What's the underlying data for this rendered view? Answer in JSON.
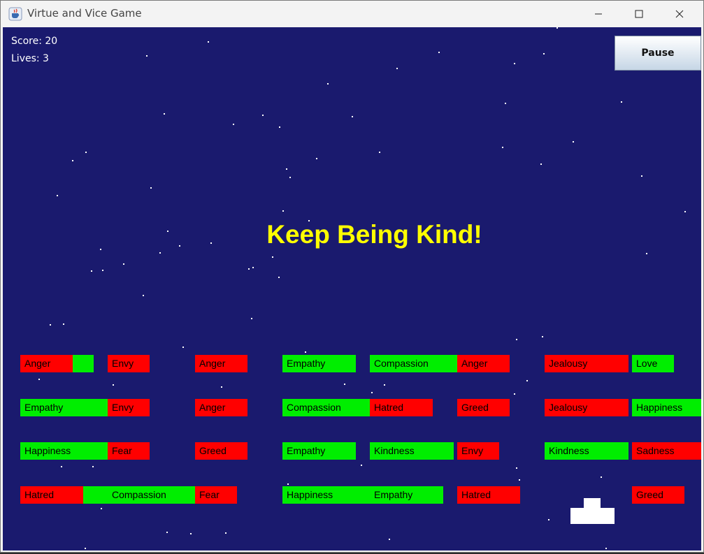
{
  "window": {
    "title": "Virtue and Vice Game",
    "icon": "java-cup-icon",
    "controls": [
      "minimize-icon",
      "maximize-icon",
      "close-icon"
    ]
  },
  "hud": {
    "score": "Score: 20",
    "lives": "Lives: 3",
    "pause_label": "Pause"
  },
  "message": "Keep Being Kind!",
  "colors": {
    "background": "#1a1a6e",
    "virtue": "#00ee00",
    "vice": "#ff0000",
    "message": "#ffff00",
    "paddle": "#ffffff",
    "star": "#ffffff"
  },
  "bricks": {
    "row1": [
      "Anger",
      "",
      "Envy",
      "Anger",
      "Empathy",
      "Compassion",
      "Anger",
      "Jealousy",
      "Love"
    ],
    "row2": [
      "Empathy",
      "Envy",
      "Anger",
      "Compassion",
      "Hatred",
      "Greed",
      "Jealousy",
      "Happiness"
    ],
    "row3": [
      "Happiness",
      "Fear",
      "Greed",
      "Empathy",
      "Kindness",
      "Envy",
      "Kindness",
      "Sadness"
    ],
    "row4": [
      "Hatred",
      "Compassion",
      "Fear",
      "Happiness",
      "Empathy",
      "Hatred",
      "Greed"
    ]
  }
}
